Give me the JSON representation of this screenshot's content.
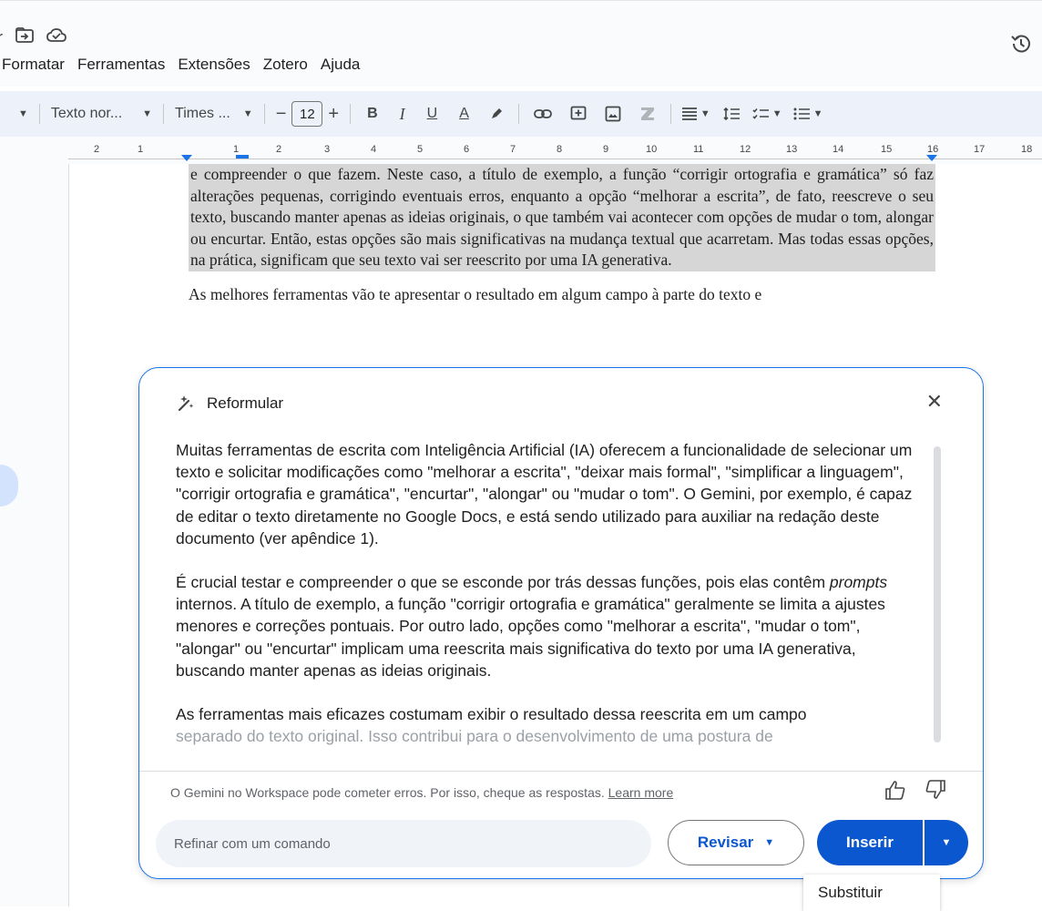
{
  "topbar": {
    "left_fragment": "r",
    "menu": [
      "Formatar",
      "Ferramentas",
      "Extensões",
      "Zotero",
      "Ajuda"
    ]
  },
  "toolbar": {
    "style_label": "Texto nor...",
    "font_label": "Times ...",
    "font_size": "12",
    "minus": "−",
    "plus": "+",
    "bold": "B",
    "italic": "I",
    "underline": "U",
    "text_color": "A"
  },
  "ruler": {
    "labels": [
      "2",
      "1",
      "1",
      "2",
      "3",
      "4",
      "5",
      "6",
      "7",
      "8",
      "9",
      "10",
      "11",
      "12",
      "13",
      "14",
      "15",
      "16",
      "17",
      "18"
    ]
  },
  "document": {
    "selected_text": "e compreender o que fazem. Neste caso, a título de exemplo, a função “corrigir ortografia e gramática” só faz alterações pequenas, corrigindo eventuais erros, enquanto a opção “melhorar a escrita”, de fato, reescreve o seu texto, buscando manter apenas as ideias originais, o que também vai acontecer com opções de mudar o tom, alongar ou encurtar. Então, estas opções são mais significativas na mudança textual que acarretam. Mas todas essas opções, na prática, significam que seu texto vai ser reescrito por uma IA generativa.",
    "next_paragraph": "As melhores ferramentas vão te apresentar o resultado em algum campo à parte do texto e"
  },
  "panel": {
    "title": "Reformular",
    "paragraphs": [
      "Muitas ferramentas de escrita com Inteligência Artificial (IA) oferecem a funcionalidade de selecionar um texto e solicitar modificações como \"melhorar a escrita\", \"deixar mais formal\", \"simplificar a linguagem\", \"corrigir ortografia e gramática\", \"encurtar\", \"alongar\" ou \"mudar o tom\". O Gemini, por exemplo, é capaz de editar o texto diretamente no Google Docs, e está sendo utilizado para auxiliar na redação deste documento (ver apêndice 1)."
    ],
    "p2_start": "É crucial testar e compreender o que se esconde por trás dessas funções, pois elas contêm ",
    "p2_italic": "prompts",
    "p2_rest": " internos. A título de exemplo, a função \"corrigir ortografia e gramática\" geralmente se limita a ajustes menores e correções pontuais. Por outro lado, opções como \"melhorar a escrita\", \"mudar o tom\", \"alongar\" ou \"encurtar\" implicam uma reescrita mais significativa do texto por uma IA generativa, buscando manter apenas as ideias originais.",
    "p3_visible": "As ferramentas mais eficazes costumam exibir o resultado dessa reescrita em um campo",
    "p3_faded": "separado do texto original. Isso contribui para o desenvolvimento de uma postura de",
    "disclaimer": "O Gemini no Workspace pode cometer erros. Por isso, cheque as respostas.",
    "learn_more": "Learn more",
    "refine_placeholder": "Refinar com um comando",
    "revisar_label": "Revisar",
    "inserir_label": "Inserir",
    "substituir_label": "Substituir"
  },
  "colors": {
    "accent": "#0b57d0",
    "panel_border": "#1a73e8",
    "selection": "#d6d6d6"
  }
}
